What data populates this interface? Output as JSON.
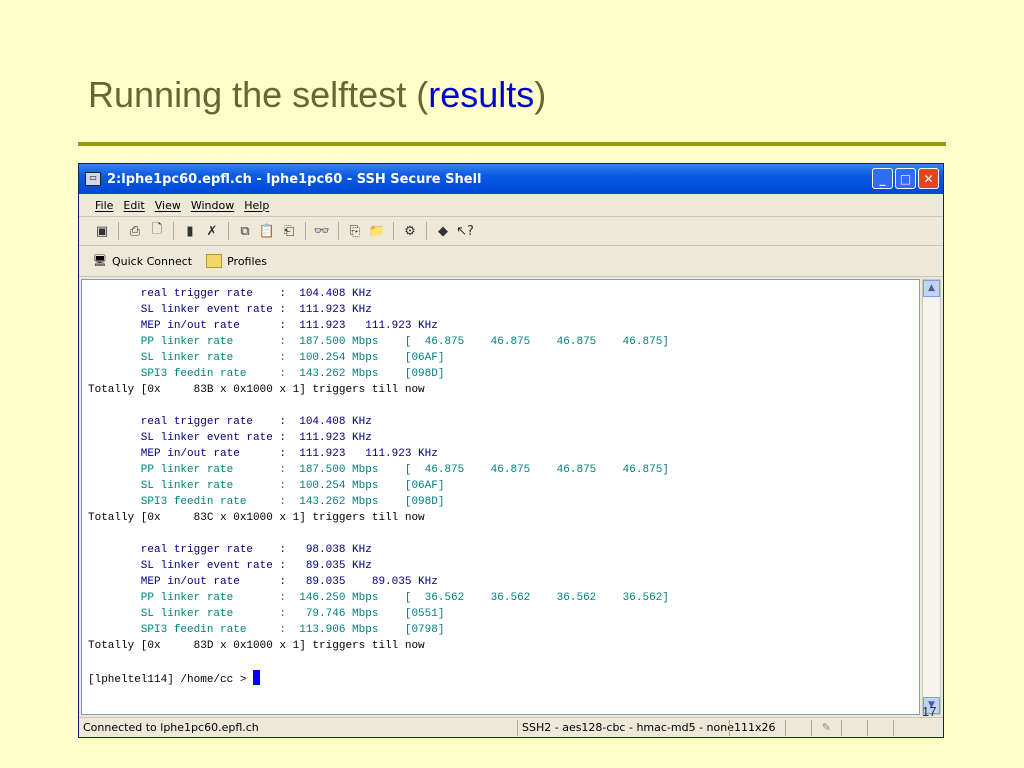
{
  "slide": {
    "title_prefix": "Running the selftest (",
    "title_accent": "results",
    "title_suffix": ")",
    "page_number": "17"
  },
  "window": {
    "title": "2:lphe1pc60.epfl.ch - lphe1pc60 - SSH Secure Shell",
    "menu": [
      "File",
      "Edit",
      "View",
      "Window",
      "Help"
    ],
    "quick_connect": "Quick Connect",
    "profiles": "Profiles"
  },
  "terminal": {
    "blocks": [
      {
        "real_trigger": "        real trigger rate    :  104.408 KHz",
        "sl_event": "        SL linker event rate :  111.923 KHz",
        "mep": "        MEP in/out rate      :  111.923   111.923 KHz",
        "pp": "        PP linker rate       :  187.500 Mbps    [  46.875    46.875    46.875    46.875]",
        "sl_rate": "        SL linker rate       :  100.254 Mbps    [06AF]",
        "spi3": "        SPI3 feedin rate     :  143.262 Mbps    [098D]",
        "totally": "Totally [0x     83B x 0x1000 x 1] triggers till now"
      },
      {
        "real_trigger": "        real trigger rate    :  104.408 KHz",
        "sl_event": "        SL linker event rate :  111.923 KHz",
        "mep": "        MEP in/out rate      :  111.923   111.923 KHz",
        "pp": "        PP linker rate       :  187.500 Mbps    [  46.875    46.875    46.875    46.875]",
        "sl_rate": "        SL linker rate       :  100.254 Mbps    [06AF]",
        "spi3": "        SPI3 feedin rate     :  143.262 Mbps    [098D]",
        "totally": "Totally [0x     83C x 0x1000 x 1] triggers till now"
      },
      {
        "real_trigger": "        real trigger rate    :   98.038 KHz",
        "sl_event": "        SL linker event rate :   89.035 KHz",
        "mep": "        MEP in/out rate      :   89.035    89.035 KHz",
        "pp": "        PP linker rate       :  146.250 Mbps    [  36.562    36.562    36.562    36.562]",
        "sl_rate": "        SL linker rate       :   79.746 Mbps    [0551]",
        "spi3": "        SPI3 feedin rate     :  113.906 Mbps    [0798]",
        "totally": "Totally [0x     83D x 0x1000 x 1] triggers till now"
      }
    ],
    "prompt": "[lpheltel114] /home/cc > "
  },
  "status": {
    "connection": "Connected to lphe1pc60.epfl.ch",
    "cipher": "SSH2 - aes128-cbc - hmac-md5 - none",
    "size": "111x26"
  },
  "colors": {
    "background": "#ffffcc",
    "title": "#666633",
    "accent": "#0000cc",
    "rule": "#999900"
  }
}
